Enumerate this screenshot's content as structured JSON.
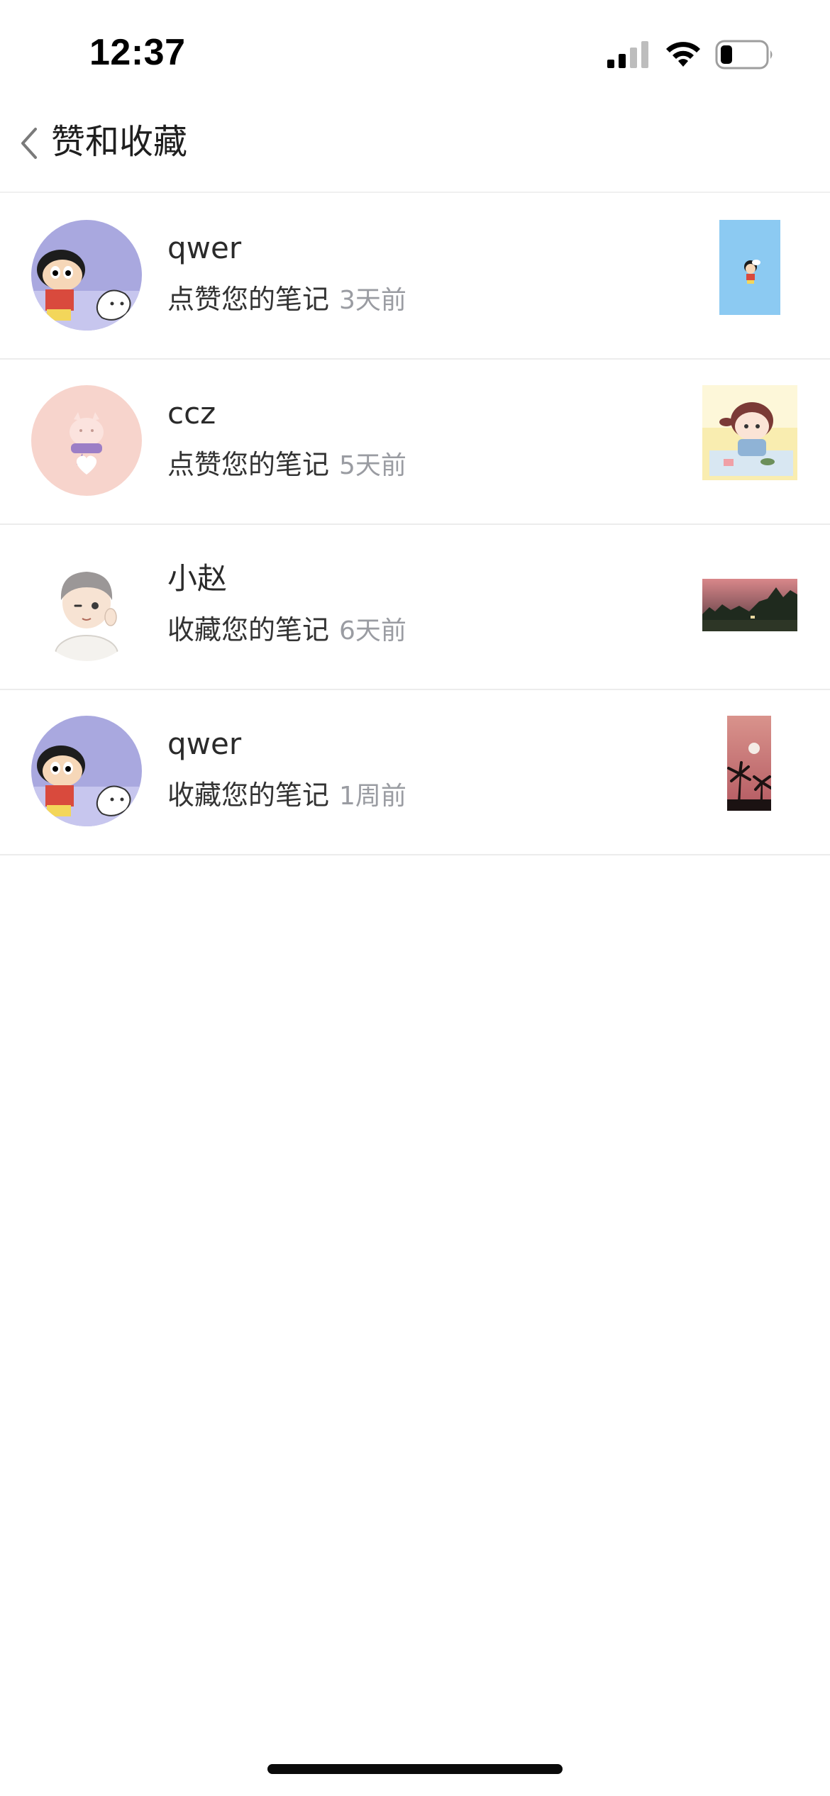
{
  "status_bar": {
    "time": "12:37",
    "icons": [
      "cellular-signal-icon",
      "wifi-icon",
      "battery-icon"
    ]
  },
  "nav": {
    "back_icon": "chevron-left-icon",
    "title": "赞和收藏"
  },
  "notifications": [
    {
      "name": "qwer",
      "action": "点赞您的笔记",
      "time": "3天前",
      "avatar": "cartoon-boy-dog-avatar",
      "thumb": "blue-cartoon-note-thumbnail"
    },
    {
      "name": "ccz",
      "action": "点赞您的笔记",
      "time": "5天前",
      "avatar": "pink-pig-avatar",
      "thumb": "cartoon-girl-note-thumbnail"
    },
    {
      "name": "小赵",
      "action": "收藏您的笔记",
      "time": "6天前",
      "avatar": "boy-waving-avatar",
      "thumb": "dusk-forest-note-thumbnail"
    },
    {
      "name": "qwer",
      "action": "收藏您的笔记",
      "time": "1周前",
      "avatar": "cartoon-boy-dog-avatar",
      "thumb": "palm-sunset-note-thumbnail"
    }
  ],
  "colors": {
    "secondary_text": "#9a9ca2",
    "divider": "#ececec"
  }
}
